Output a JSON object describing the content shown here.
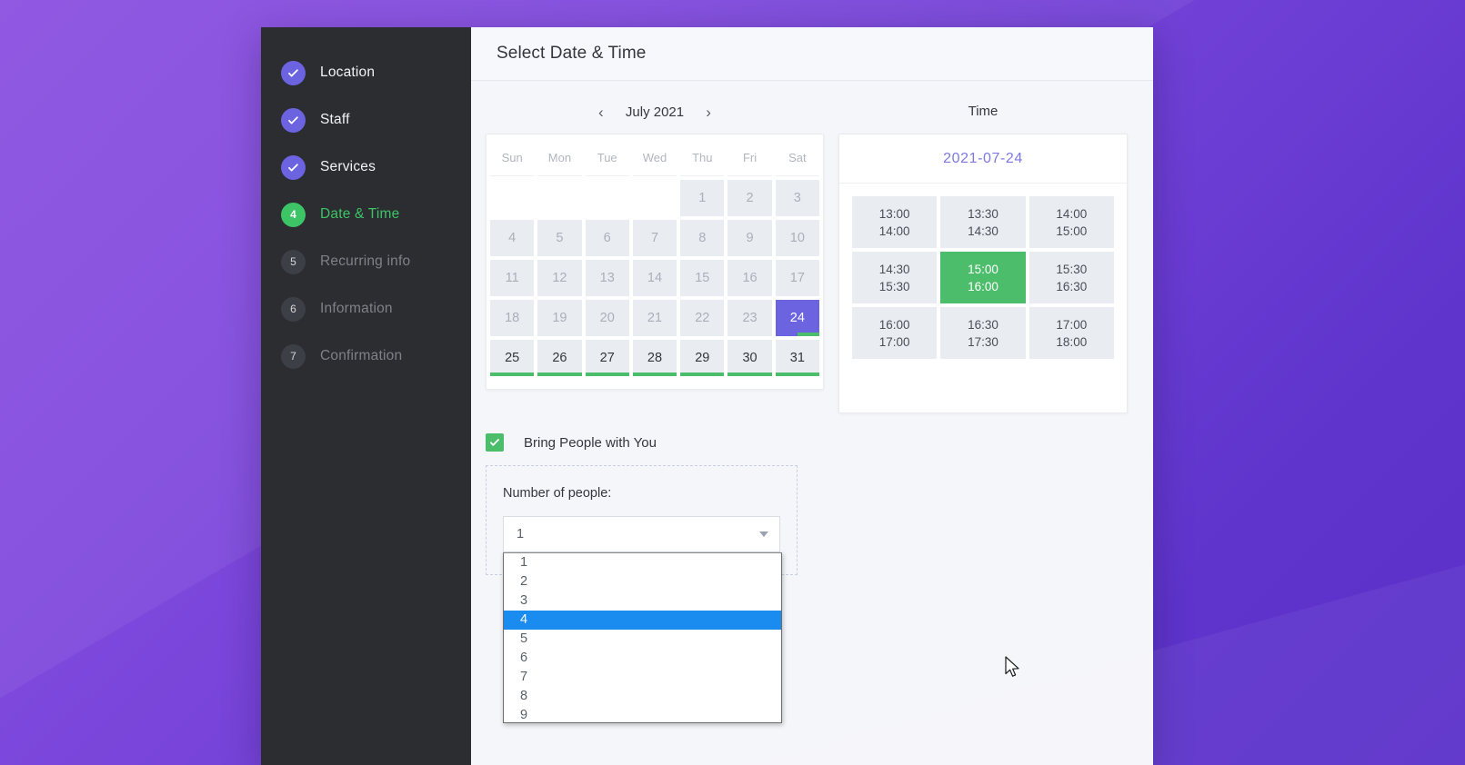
{
  "theme": {
    "bg_gradient_from": "#8b4fe0",
    "bg_gradient_to": "#5b30c9",
    "sidebar_bg": "#2b2d31",
    "accent_purple": "#6c63e0",
    "accent_green": "#4cbd6a",
    "highlight_blue": "#1a8cf0"
  },
  "sidebar": {
    "steps": [
      {
        "num": "1",
        "label": "Location",
        "state": "done",
        "icon": "check-icon"
      },
      {
        "num": "2",
        "label": "Staff",
        "state": "done",
        "icon": "check-icon"
      },
      {
        "num": "3",
        "label": "Services",
        "state": "done",
        "icon": "check-icon"
      },
      {
        "num": "4",
        "label": "Date & Time",
        "state": "active",
        "icon": ""
      },
      {
        "num": "5",
        "label": "Recurring info",
        "state": "todo",
        "icon": ""
      },
      {
        "num": "6",
        "label": "Information",
        "state": "todo",
        "icon": ""
      },
      {
        "num": "7",
        "label": "Confirmation",
        "state": "todo",
        "icon": ""
      }
    ]
  },
  "header": {
    "title": "Select Date & Time"
  },
  "calendar": {
    "prev_icon": "‹",
    "next_icon": "›",
    "month_label": "July 2021",
    "weekdays": [
      "Sun",
      "Mon",
      "Tue",
      "Wed",
      "Thu",
      "Fri",
      "Sat"
    ],
    "weeks": [
      [
        {
          "label": "",
          "state": "empty"
        },
        {
          "label": "",
          "state": "empty"
        },
        {
          "label": "",
          "state": "empty"
        },
        {
          "label": "",
          "state": "empty"
        },
        {
          "label": "1",
          "state": "disabled"
        },
        {
          "label": "2",
          "state": "disabled"
        },
        {
          "label": "3",
          "state": "disabled"
        }
      ],
      [
        {
          "label": "4",
          "state": "disabled"
        },
        {
          "label": "5",
          "state": "disabled"
        },
        {
          "label": "6",
          "state": "disabled"
        },
        {
          "label": "7",
          "state": "disabled"
        },
        {
          "label": "8",
          "state": "disabled"
        },
        {
          "label": "9",
          "state": "disabled"
        },
        {
          "label": "10",
          "state": "disabled"
        }
      ],
      [
        {
          "label": "11",
          "state": "disabled"
        },
        {
          "label": "12",
          "state": "disabled"
        },
        {
          "label": "13",
          "state": "disabled"
        },
        {
          "label": "14",
          "state": "disabled"
        },
        {
          "label": "15",
          "state": "disabled"
        },
        {
          "label": "16",
          "state": "disabled"
        },
        {
          "label": "17",
          "state": "disabled"
        }
      ],
      [
        {
          "label": "18",
          "state": "disabled"
        },
        {
          "label": "19",
          "state": "disabled"
        },
        {
          "label": "20",
          "state": "disabled"
        },
        {
          "label": "21",
          "state": "disabled"
        },
        {
          "label": "22",
          "state": "disabled"
        },
        {
          "label": "23",
          "state": "disabled"
        },
        {
          "label": "24",
          "state": "selected"
        }
      ],
      [
        {
          "label": "25",
          "state": "available"
        },
        {
          "label": "26",
          "state": "available"
        },
        {
          "label": "27",
          "state": "available"
        },
        {
          "label": "28",
          "state": "available"
        },
        {
          "label": "29",
          "state": "available"
        },
        {
          "label": "30",
          "state": "available"
        },
        {
          "label": "31",
          "state": "available"
        }
      ]
    ]
  },
  "time": {
    "title": "Time",
    "selected_date": "2021-07-24",
    "slots": [
      {
        "start": "13:00",
        "end": "14:00",
        "state": "normal"
      },
      {
        "start": "13:30",
        "end": "14:30",
        "state": "normal"
      },
      {
        "start": "14:00",
        "end": "15:00",
        "state": "normal"
      },
      {
        "start": "14:30",
        "end": "15:30",
        "state": "normal"
      },
      {
        "start": "15:00",
        "end": "16:00",
        "state": "selected"
      },
      {
        "start": "15:30",
        "end": "16:30",
        "state": "normal"
      },
      {
        "start": "16:00",
        "end": "17:00",
        "state": "normal"
      },
      {
        "start": "16:30",
        "end": "17:30",
        "state": "normal"
      },
      {
        "start": "17:00",
        "end": "18:00",
        "state": "normal"
      }
    ]
  },
  "bring_people": {
    "checkbox_label": "Bring People with You",
    "checked": true,
    "checkbox_icon": "check-icon",
    "people_label": "Number of people:",
    "select_value": "1",
    "dropdown_open": true,
    "highlighted_option": "4",
    "options": [
      "1",
      "2",
      "3",
      "4",
      "5",
      "6",
      "7",
      "8",
      "9"
    ]
  }
}
